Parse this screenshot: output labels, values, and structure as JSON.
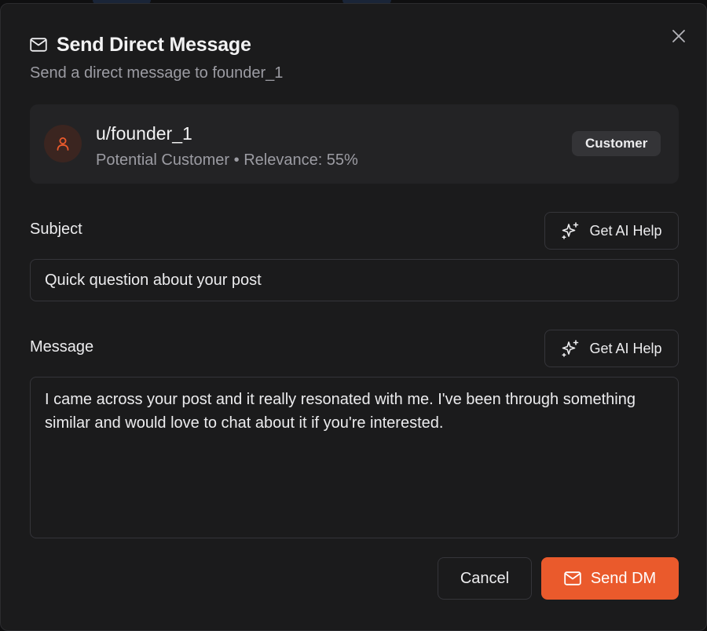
{
  "dialog": {
    "title": "Send Direct Message",
    "subtitle": "Send a direct message to founder_1",
    "close_icon": "x-icon",
    "title_icon": "mail-icon"
  },
  "recipient": {
    "username": "u/founder_1",
    "meta": "Potential Customer • Relevance: 55%",
    "badge": "Customer",
    "avatar_icon": "user-icon"
  },
  "subject": {
    "label": "Subject",
    "ai_help_label": "Get AI Help",
    "value": "Quick question about your post"
  },
  "message": {
    "label": "Message",
    "ai_help_label": "Get AI Help",
    "value": "I came across your post and it really resonated with me. I've been through something similar and would love to chat about it if you're interested."
  },
  "actions": {
    "cancel_label": "Cancel",
    "send_label": "Send DM"
  },
  "colors": {
    "accent": "#ea5a2c",
    "background": "#1b1b1c",
    "card": "#232325",
    "muted_text": "#9c9ca3"
  }
}
